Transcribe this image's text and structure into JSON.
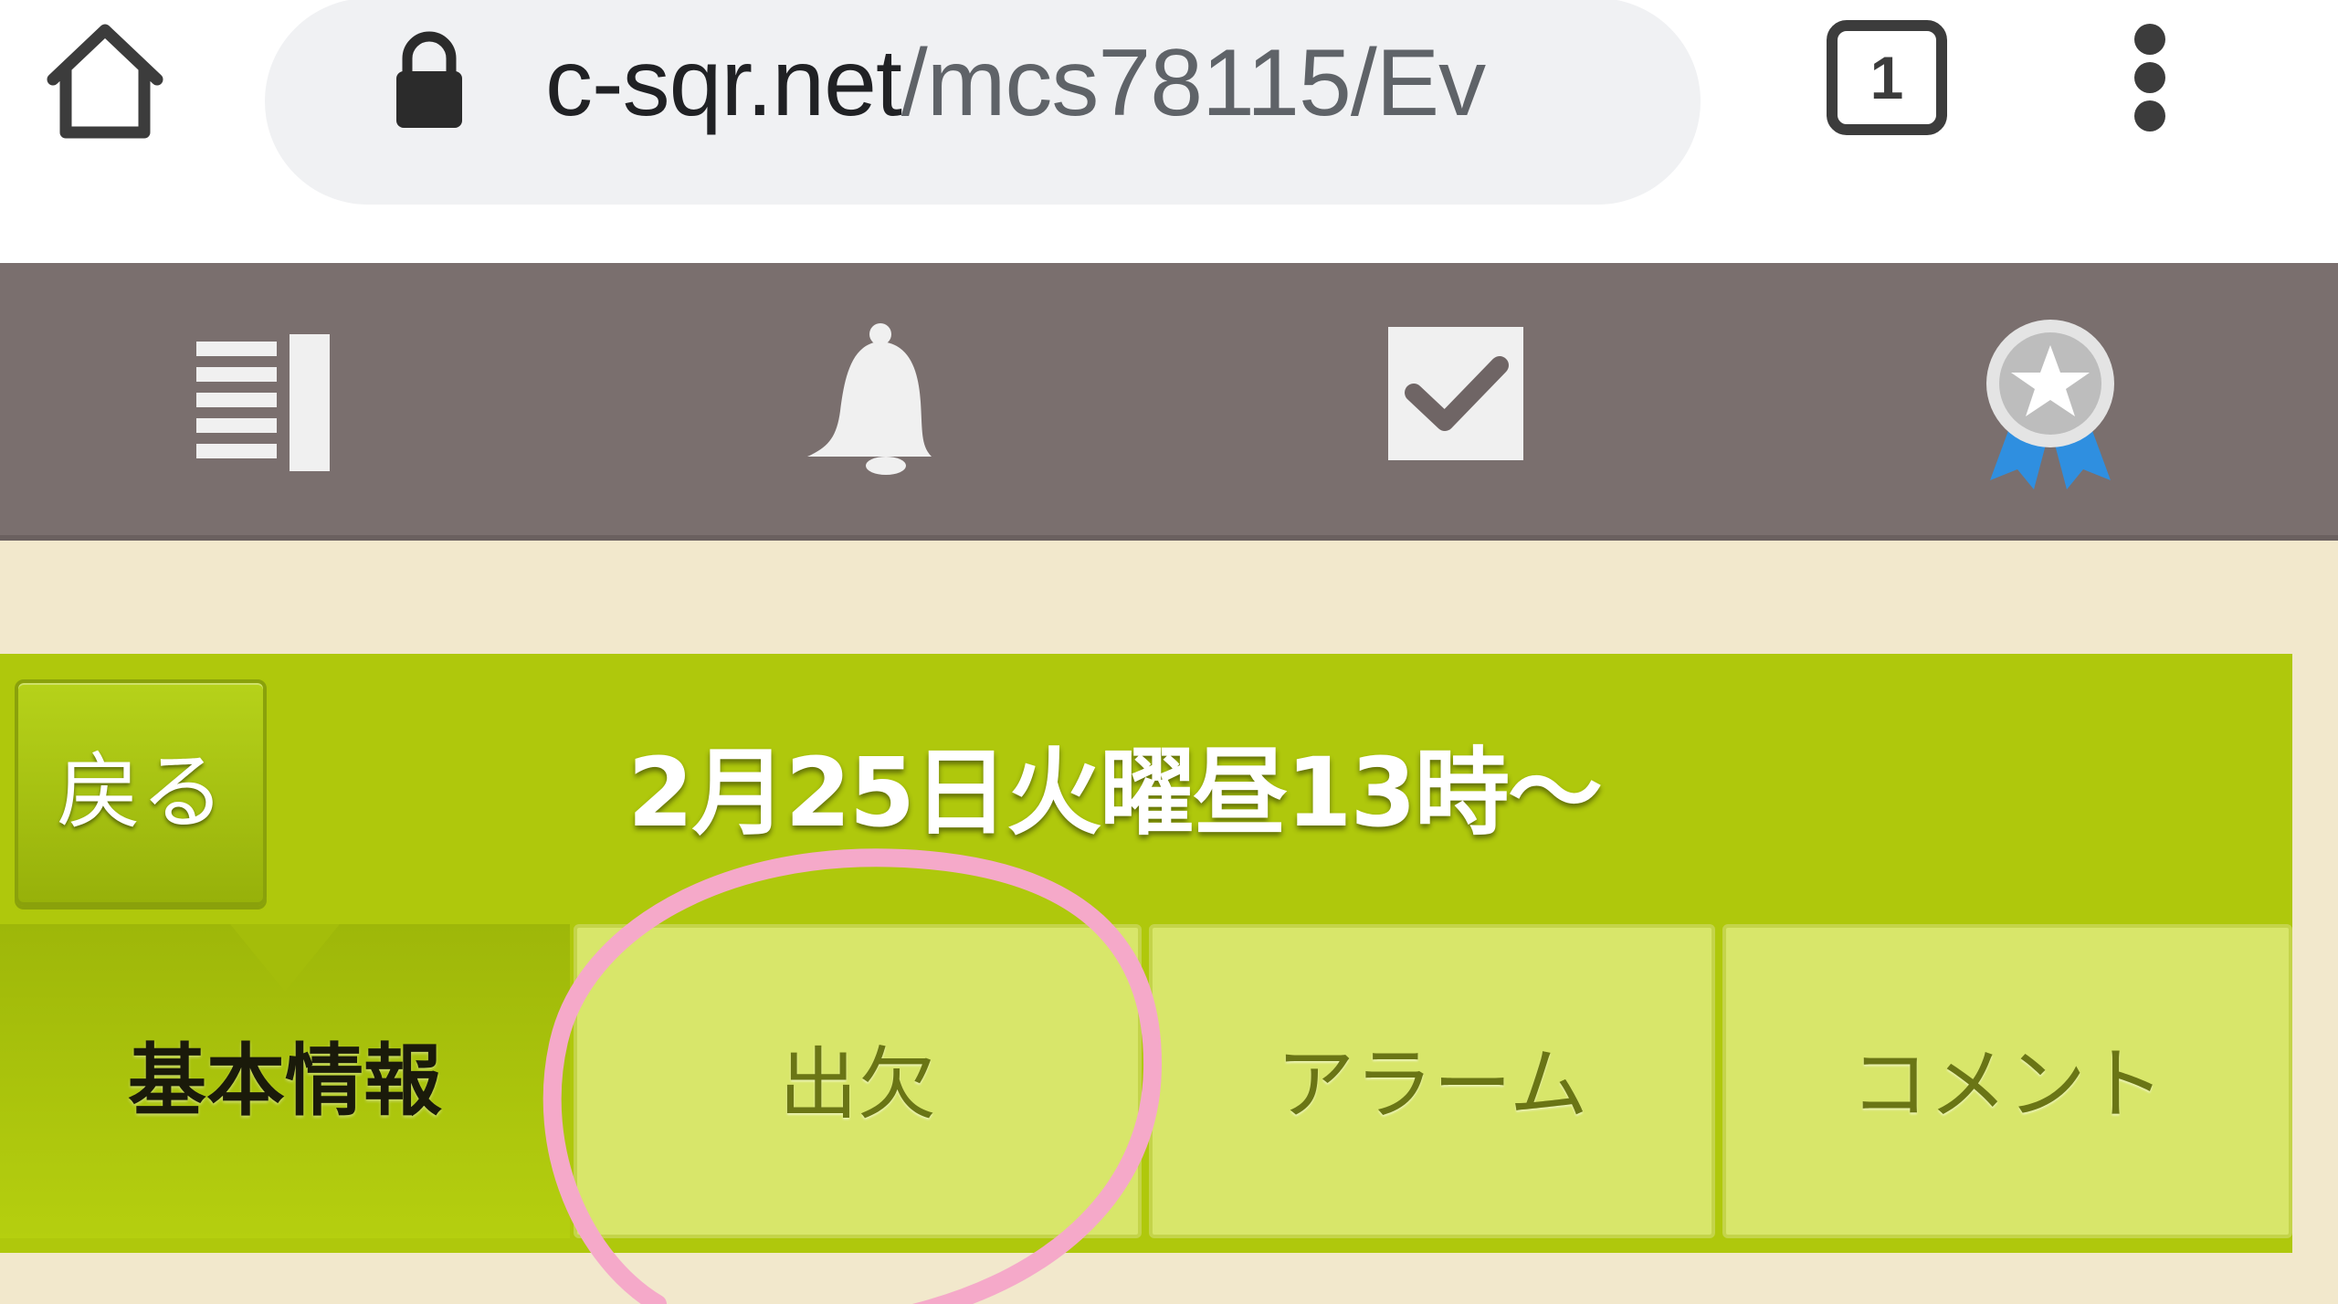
{
  "browser": {
    "url_host": "c-sqr.net",
    "url_path": "/mcs78115/Ev",
    "tab_count": "1",
    "icons": [
      "home-icon",
      "lock-icon",
      "tabs-icon",
      "more-vert-icon"
    ]
  },
  "app_nav": {
    "items": [
      {
        "name": "list",
        "icon": "list-icon"
      },
      {
        "name": "notifications",
        "icon": "bell-icon"
      },
      {
        "name": "tasks",
        "icon": "checkbox-icon"
      },
      {
        "name": "awards",
        "icon": "award-ribbon-icon"
      }
    ],
    "colors": {
      "background": "#7a6f6e",
      "icon": "#f0f0f0",
      "ribbon": "#2f8fe0"
    }
  },
  "event": {
    "back_label": "戻る",
    "title": "2月25日火曜昼13時～",
    "tabs": [
      {
        "label": "基本情報",
        "active": true
      },
      {
        "label": "出欠",
        "active": false
      },
      {
        "label": "アラーム",
        "active": false
      },
      {
        "label": "コメント",
        "active": false
      }
    ],
    "colors": {
      "panel": "#afc80c",
      "tab_inactive": "#d8e66a",
      "background": "#f2e8cc"
    }
  },
  "annotation": {
    "shape": "circle",
    "color": "#f5a9c9",
    "target": "出欠"
  }
}
